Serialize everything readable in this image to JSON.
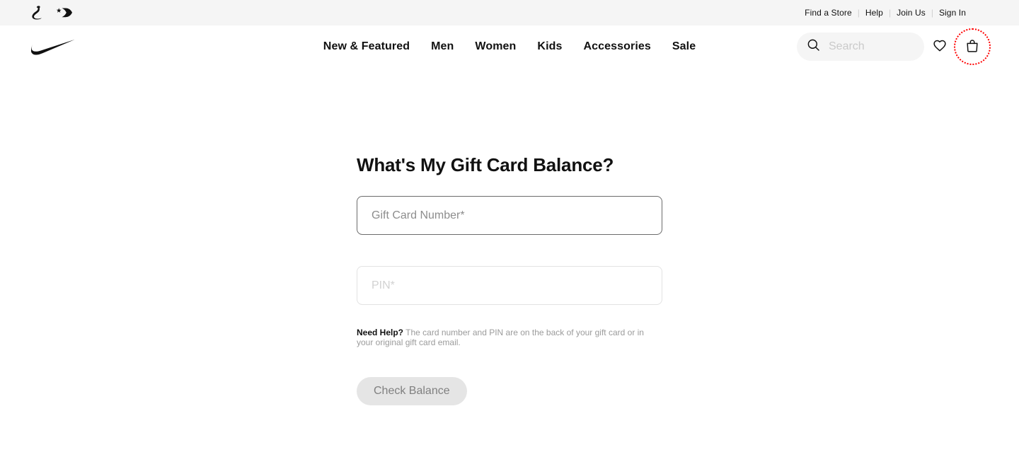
{
  "topbar": {
    "brands": [
      {
        "name": "jordan-logo",
        "label": "Jordan"
      },
      {
        "name": "converse-logo",
        "label": "Converse"
      }
    ],
    "links": [
      {
        "label": "Find a Store"
      },
      {
        "label": "Help"
      },
      {
        "label": "Join Us"
      },
      {
        "label": "Sign In"
      }
    ],
    "separator": "|",
    "background": "#f5f5f5"
  },
  "header": {
    "logo_label": "Nike",
    "nav": [
      {
        "label": "New & Featured"
      },
      {
        "label": "Men"
      },
      {
        "label": "Women"
      },
      {
        "label": "Kids"
      },
      {
        "label": "Accessories"
      },
      {
        "label": "Sale"
      }
    ],
    "search": {
      "placeholder": "Search",
      "value": "",
      "icon": "search-icon"
    },
    "favorites_icon": "heart-icon",
    "bag_icon": "bag-icon",
    "bag_focus_ring_color": "#ff0000"
  },
  "main": {
    "title": "What's My Gift Card Balance?",
    "gift_card_field": {
      "placeholder": "Gift Card Number*",
      "value": ""
    },
    "pin_field": {
      "placeholder": "PIN*",
      "value": ""
    },
    "help": {
      "strong": "Need Help?",
      "text": "The card number and PIN are on the back of your gift card or in your original gift card email."
    },
    "submit_label": "Check Balance"
  }
}
